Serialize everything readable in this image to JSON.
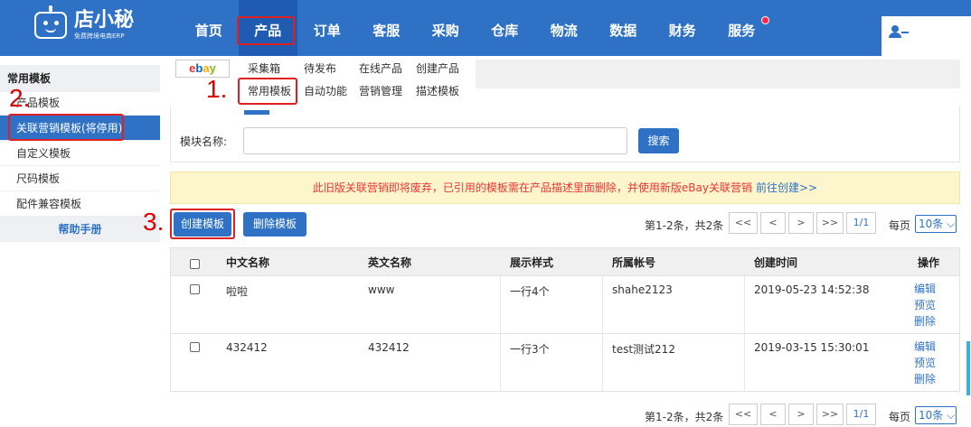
{
  "brand": {
    "name": "店小秘",
    "tagline": "免费跨境电商ERP"
  },
  "nav": [
    "首页",
    "产品",
    "订单",
    "客服",
    "采购",
    "仓库",
    "物流",
    "数据",
    "财务",
    "服务"
  ],
  "sidebar": {
    "title": "常用模板",
    "items": [
      "产品模板",
      "关联营销模板(将停用)",
      "自定义模板",
      "尺码模板",
      "配件兼容模板"
    ],
    "help": "帮助手册"
  },
  "steps": {
    "s1": "1.",
    "s2": "2.",
    "s3": "3."
  },
  "subtabs": {
    "row1": [
      "采集箱",
      "待发布",
      "在线产品",
      "创建产品"
    ],
    "row2": [
      "常用模板",
      "自动功能",
      "营销管理",
      "描述模板"
    ]
  },
  "search": {
    "label": "模块名称:",
    "value": "",
    "button": "搜索"
  },
  "notice": {
    "text": "此旧版关联营销即将废弃，已引用的模板需在产品描述里面删除，并使用新版eBay关联营销",
    "link": "前往创建>>"
  },
  "toolbar": {
    "create": "创建模板",
    "delete": "删除模板"
  },
  "pager": {
    "info": "第1-2条，共2条",
    "first": "<<",
    "prev": "<",
    "next": ">",
    "last": ">>",
    "page": "1/1",
    "per_label": "每页",
    "per_value": "10条"
  },
  "table": {
    "columns": [
      "中文名称",
      "英文名称",
      "展示样式",
      "所属帐号",
      "创建时间",
      "操作"
    ],
    "rows": [
      {
        "cn": "啦啦",
        "en": "www",
        "style": "一行4个",
        "account": "shahe2123",
        "time": "2019-05-23 14:52:38"
      },
      {
        "cn": "432412",
        "en": "432412",
        "style": "一行3个",
        "account": "test测试212",
        "time": "2019-03-15 15:30:01"
      }
    ],
    "ops": [
      "编辑",
      "预览",
      "删除"
    ]
  },
  "colors": {
    "primary": "#2f72c5",
    "highlight": "#e02020",
    "notice_bg": "#fdf6cc"
  }
}
